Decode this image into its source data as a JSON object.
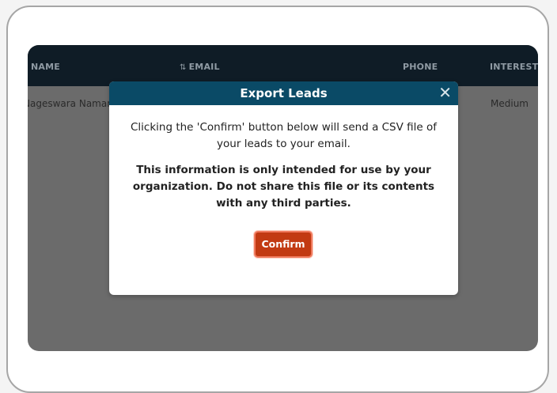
{
  "table": {
    "columns": {
      "name": "NAME",
      "email_sort_icon": "⇅",
      "email": "EMAIL",
      "phone": "PHONE",
      "interest": "INTEREST L"
    },
    "rows": [
      {
        "name": "Nageswara Naman",
        "interest": "Medium"
      }
    ]
  },
  "modal": {
    "title": "Export Leads",
    "close_symbol": "✕",
    "message": "Clicking the 'Confirm' button below will send a CSV file of your leads to your email.",
    "warning": "This information is only intended for use by your organization. Do not share this file or its contents with any third parties.",
    "confirm_label": "Confirm"
  },
  "colors": {
    "header_bg": "#0a4a66",
    "table_header_bg": "#0f1c26",
    "confirm_bg": "#c23a12",
    "overlay": "#6b6b6b"
  }
}
